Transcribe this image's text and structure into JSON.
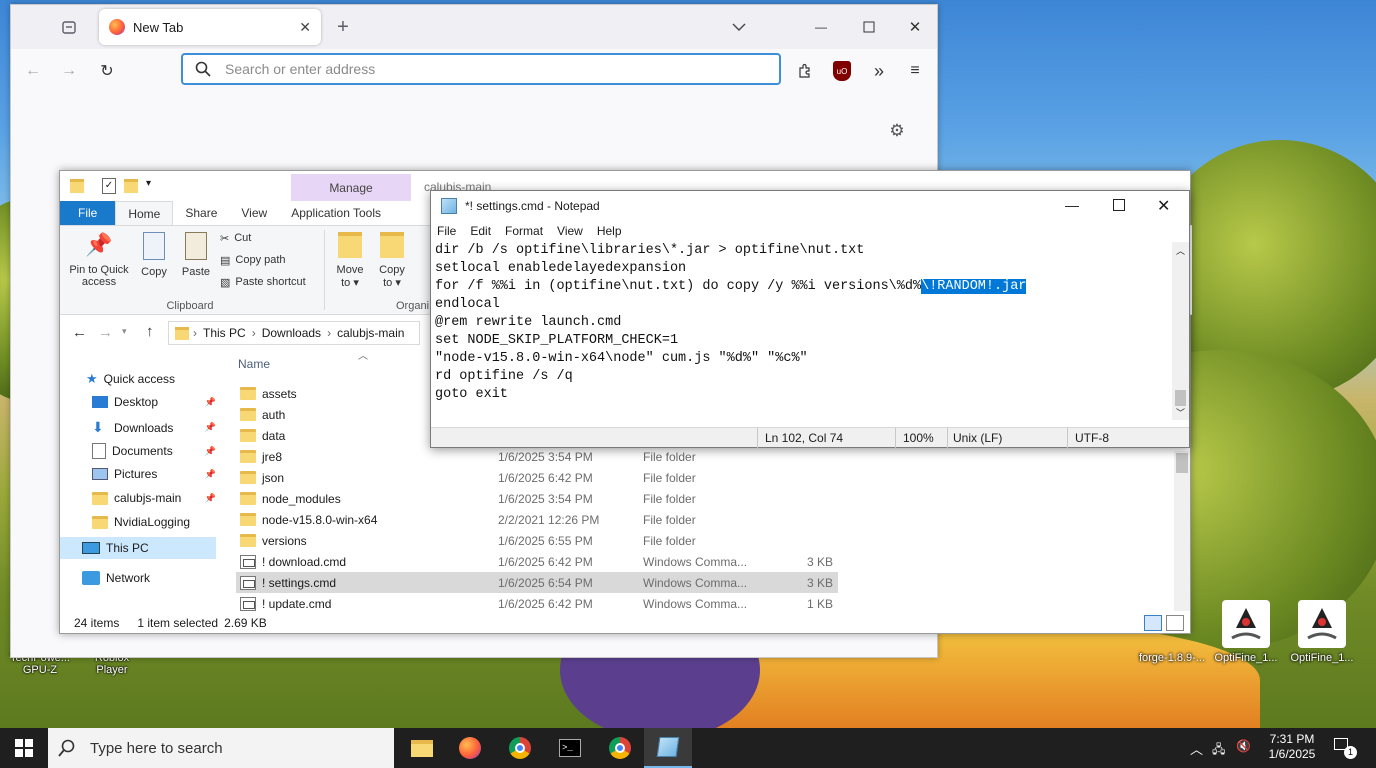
{
  "browser": {
    "tab_title": "New Tab",
    "url_placeholder": "Search or enter address"
  },
  "explorer": {
    "window_title": "calubjs-main",
    "manage_tab": "Manage",
    "ribbon_tabs": [
      "File",
      "Home",
      "Share",
      "View",
      "Application Tools"
    ],
    "ribbon": {
      "pin_label": "Pin to Quick access",
      "copy_label": "Copy",
      "paste_label": "Paste",
      "cut_label": "Cut",
      "copy_path_label": "Copy path",
      "paste_shortcut_label": "Paste shortcut",
      "clipboard_group": "Clipboard",
      "move_to_label": "Move to",
      "copy_to_label": "Copy to",
      "organize_group": "Organi"
    },
    "breadcrumb": [
      "This PC",
      "Downloads",
      "calubjs-main"
    ],
    "nav": {
      "quick_access": "Quick access",
      "items": [
        {
          "label": "Desktop"
        },
        {
          "label": "Downloads"
        },
        {
          "label": "Documents"
        },
        {
          "label": "Pictures"
        },
        {
          "label": "calubjs-main"
        },
        {
          "label": "NvidiaLogging"
        }
      ],
      "this_pc": "This PC",
      "network": "Network"
    },
    "column_name": "Name",
    "files": [
      {
        "name": "assets",
        "date": "",
        "type": "",
        "size": "",
        "kind": "folder"
      },
      {
        "name": "auth",
        "date": "",
        "type": "",
        "size": "",
        "kind": "folder"
      },
      {
        "name": "data",
        "date": "",
        "type": "",
        "size": "",
        "kind": "folder"
      },
      {
        "name": "jre8",
        "date": "1/6/2025 3:54 PM",
        "type": "File folder",
        "size": "",
        "kind": "folder"
      },
      {
        "name": "json",
        "date": "1/6/2025 6:42 PM",
        "type": "File folder",
        "size": "",
        "kind": "folder"
      },
      {
        "name": "node_modules",
        "date": "1/6/2025 3:54 PM",
        "type": "File folder",
        "size": "",
        "kind": "folder"
      },
      {
        "name": "node-v15.8.0-win-x64",
        "date": "2/2/2021 12:26 PM",
        "type": "File folder",
        "size": "",
        "kind": "folder"
      },
      {
        "name": "versions",
        "date": "1/6/2025 6:55 PM",
        "type": "File folder",
        "size": "",
        "kind": "folder"
      },
      {
        "name": "! download.cmd",
        "date": "1/6/2025 6:42 PM",
        "type": "Windows Comma...",
        "size": "3 KB",
        "kind": "cmd"
      },
      {
        "name": "! settings.cmd",
        "date": "1/6/2025 6:54 PM",
        "type": "Windows Comma...",
        "size": "3 KB",
        "kind": "cmd"
      },
      {
        "name": "! update.cmd",
        "date": "1/6/2025 6:42 PM",
        "type": "Windows Comma...",
        "size": "1 KB",
        "kind": "cmd"
      }
    ],
    "status": {
      "items": "24 items",
      "selected": "1 item selected",
      "size": "2.69 KB"
    }
  },
  "notepad": {
    "title": "*! settings.cmd - Notepad",
    "menu": [
      "File",
      "Edit",
      "Format",
      "View",
      "Help"
    ],
    "lines": [
      "dir /b /s optifine\\libraries\\*.jar > optifine\\nut.txt",
      "setlocal enabledelayedexpansion",
      "for /f %%i in (optifine\\nut.txt) do copy /y %%i versions\\%d%",
      "endlocal",
      "@rem rewrite launch.cmd",
      "set NODE_SKIP_PLATFORM_CHECK=1",
      "\"node-v15.8.0-win-x64\\node\" cum.js \"%d%\" \"%c%\"",
      "rd optifine /s /q",
      "goto exit"
    ],
    "selected_text": "\\!RANDOM!.jar",
    "status": {
      "position": "Ln 102, Col 74",
      "zoom": "100%",
      "eol": "Unix (LF)",
      "encoding": "UTF-8"
    }
  },
  "desktop": {
    "left_icons": [
      {
        "label": "TechPowe...\nGPU-Z"
      },
      {
        "label": "Roblox\nPlayer"
      }
    ],
    "right_icons": [
      {
        "label": "forge-1.8.9-..."
      },
      {
        "label": "OptiFine_1..."
      },
      {
        "label": "OptiFine_1..."
      }
    ]
  },
  "taskbar": {
    "search_placeholder": "Type here to search",
    "time": "7:31 PM",
    "date": "1/6/2025",
    "notification_count": "1"
  }
}
